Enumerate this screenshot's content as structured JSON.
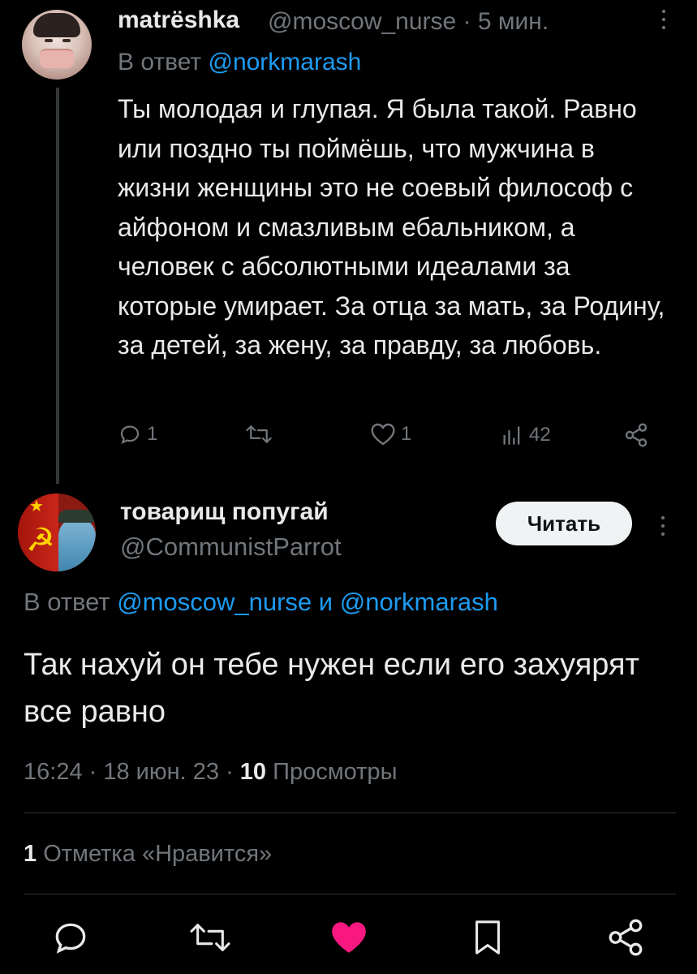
{
  "parent_tweet": {
    "display_name": "matrёshka",
    "handle": "@moscow_nurse",
    "time": "5 мин.",
    "reply_prefix": "В ответ",
    "reply_to": "@norkmarash",
    "text": "Ты молодая и глупая. Я была такой. Равно или поздно ты поймёшь, что мужчина в жизни женщины это не соевый философ с айфоном и смазливым ебальником, а человек с абсолютными идеалами за которые умирает. За отца за мать, за Родину, за детей, за жену, за правду, за любовь.",
    "replies": "1",
    "likes": "1",
    "views": "42"
  },
  "main_tweet": {
    "display_name": "товарищ попугай",
    "handle": "@CommunistParrot",
    "follow_label": "Читать",
    "reply_prefix": "В ответ",
    "reply_to_1": "@moscow_nurse",
    "reply_join": "и",
    "reply_to_2": "@norkmarash",
    "text": "Так нахуй он тебе нужен если его захуярят все равно",
    "time": "16:24",
    "date": "18 июн. 23",
    "views_count": "10",
    "views_label": "Просмотры",
    "like_count": "1",
    "like_label": "Отметка «Нравится»"
  },
  "colors": {
    "background": "#000000",
    "text": "#e7e9ea",
    "muted": "#71767b",
    "link": "#1d9bf0",
    "like_active": "#f91880"
  }
}
